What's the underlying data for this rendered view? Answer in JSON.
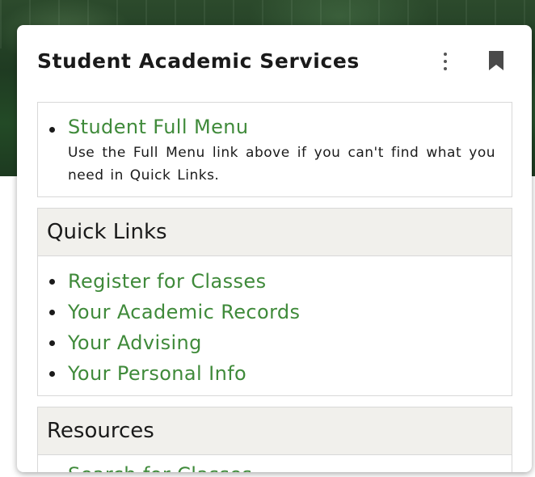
{
  "card": {
    "title": "Student Academic Services"
  },
  "header_icons": {
    "menu": "more-vertical-icon",
    "bookmark": "bookmark-icon"
  },
  "full_menu": {
    "link": "Student Full Menu",
    "description": "Use the Full Menu link above if you can't find what you need in Quick Links."
  },
  "quick_links": {
    "title": "Quick Links",
    "items": [
      "Register for Classes",
      "Your Academic Records",
      "Your Advising",
      "Your Personal Info"
    ]
  },
  "resources": {
    "title": "Resources",
    "items": [
      "Search for Classes"
    ]
  },
  "colors": {
    "link": "#3f8a3a",
    "section_header_bg": "#f1f0ec"
  }
}
